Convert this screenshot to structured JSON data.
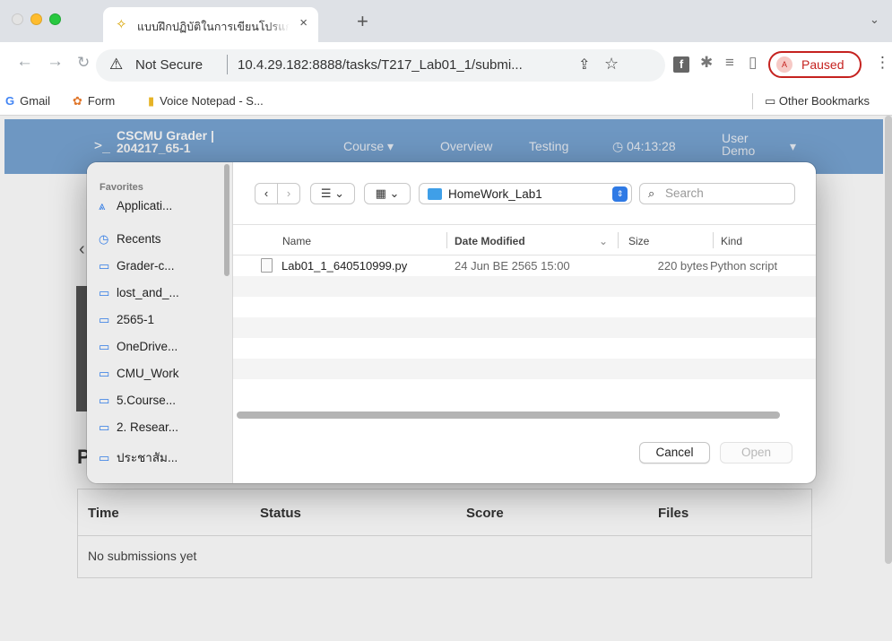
{
  "browser": {
    "tab_title": "แบบฝึกปฏิบัติในการเขียนโปรแกรม",
    "new_tab": "+",
    "tab_close": "×",
    "tab_menu": "⌄",
    "security_label": "Not Secure",
    "url": "10.4.29.182:8888/tasks/T217_Lab01_1/submi...",
    "profile_status": "Paused",
    "profile_initial": "A",
    "bookmarks": [
      {
        "icon": "G",
        "label": "Gmail"
      },
      {
        "icon": "✿",
        "label": "Form"
      },
      {
        "icon": "▮",
        "label": "Voice Notepad - S..."
      }
    ],
    "other_bookmarks": "Other Bookmarks"
  },
  "app": {
    "brand_line1": "CSCMU Grader |",
    "brand_line2": "204217_65-1",
    "nav": {
      "course": "Course",
      "overview": "Overview",
      "testing": "Testing",
      "timer": "04:13:28",
      "user": "User Demo"
    },
    "section_heading": "P",
    "table_headers": [
      "Time",
      "Status",
      "Score",
      "Files"
    ],
    "empty_message": "No submissions yet"
  },
  "dialog": {
    "favorites_title": "Favorites",
    "sidebar_items": [
      {
        "icon": "app",
        "label": "Applicati..."
      },
      {
        "icon": "clock",
        "label": "Recents"
      },
      {
        "icon": "folder",
        "label": "Grader-c..."
      },
      {
        "icon": "folder",
        "label": "lost_and_..."
      },
      {
        "icon": "folder",
        "label": "2565-1"
      },
      {
        "icon": "folder",
        "label": "OneDrive..."
      },
      {
        "icon": "folder",
        "label": "CMU_Work"
      },
      {
        "icon": "folder",
        "label": "5.Course..."
      },
      {
        "icon": "folder",
        "label": "2. Resear..."
      },
      {
        "icon": "folder",
        "label": "ประชาสัม..."
      }
    ],
    "location": "HomeWork_Lab1",
    "search_placeholder": "Search",
    "columns": {
      "name": "Name",
      "date": "Date Modified",
      "size": "Size",
      "kind": "Kind"
    },
    "files": [
      {
        "name": "Lab01_1_640510999.py",
        "date": "24 Jun BE 2565 15:00",
        "size": "220 bytes",
        "kind": "Python script"
      }
    ],
    "cancel_label": "Cancel",
    "open_label": "Open"
  }
}
